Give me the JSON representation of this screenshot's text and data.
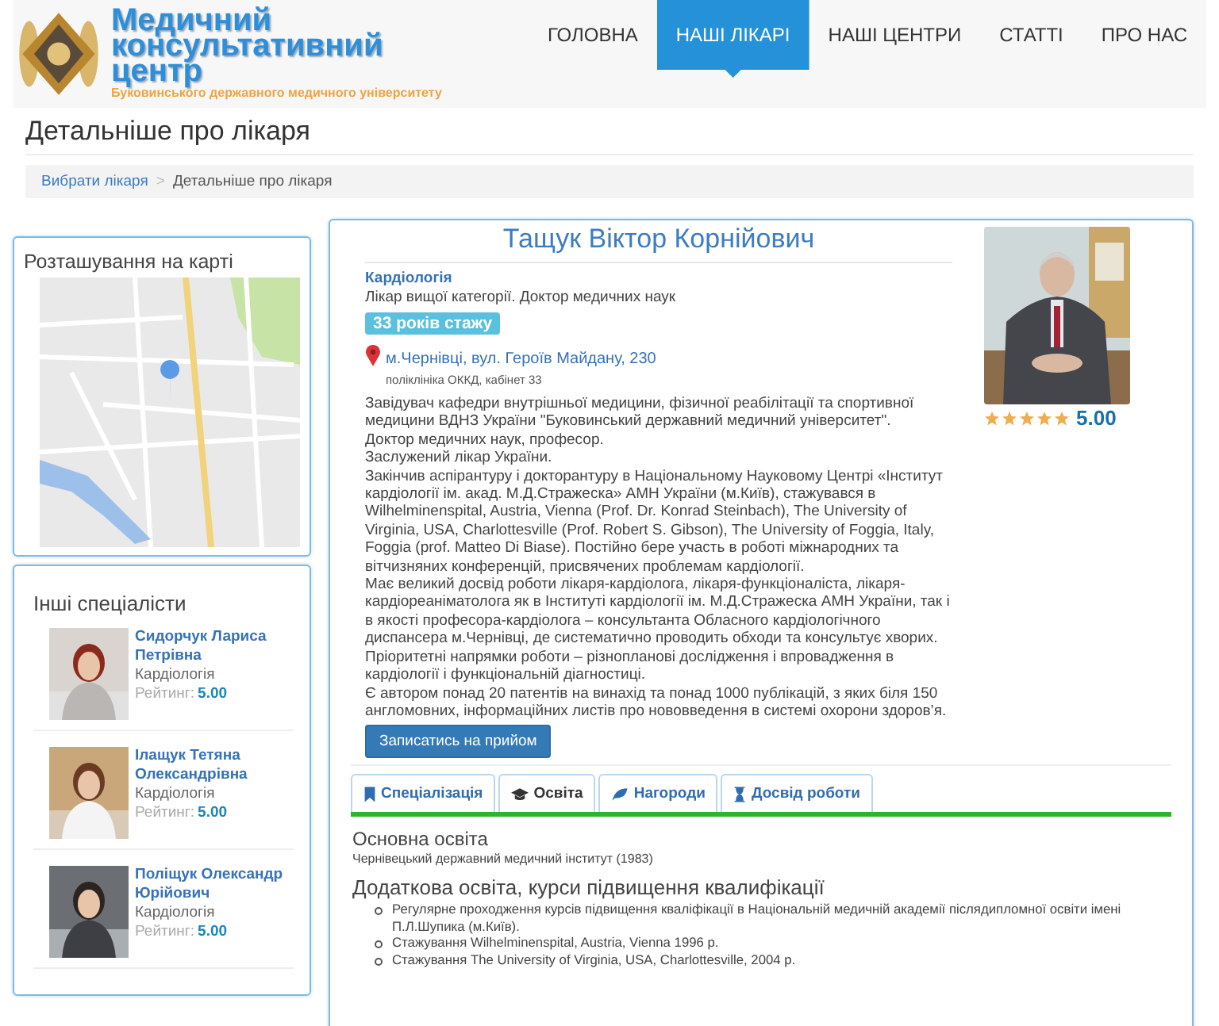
{
  "header": {
    "title": "Медичний консультативний центр",
    "subtitle": "Буковинського державного медичного університету",
    "nav": [
      {
        "label": "ГОЛОВНА",
        "selected": false
      },
      {
        "label": "НАШІ ЛІКАРІ",
        "selected": true
      },
      {
        "label": "НАШІ ЦЕНТРИ",
        "selected": false
      },
      {
        "label": "СТАТТІ",
        "selected": false
      },
      {
        "label": "ПРО НАС",
        "selected": false
      }
    ]
  },
  "page_title": "Детальніше про лікаря",
  "breadcrumb": {
    "separator": ">",
    "items": [
      {
        "label": "Вибрати лікаря",
        "kind": "link"
      },
      {
        "label": "Детальніше про лікаря",
        "kind": "current"
      }
    ]
  },
  "map_card": {
    "title": "Розташування на карті"
  },
  "others": {
    "title": "Інші спеціалісти",
    "doctors": [
      {
        "name": "Сидорчук Лариса Петрівна",
        "specialty": "Кардіологія",
        "rating_label": "Рейтинг:",
        "rating": "5.00"
      },
      {
        "name": "Ілащук Тетяна Олександрівна",
        "specialty": "Кардіологія",
        "rating_label": "Рейтинг:",
        "rating": "5.00"
      },
      {
        "name": "Поліщук Олександр Юрійович",
        "specialty": "Кардіологія",
        "rating_label": "Рейтинг:",
        "rating": "5.00"
      }
    ]
  },
  "doctor": {
    "name": "Тащук Віктор Корнійович",
    "specialty": "Кардіологія",
    "degree": "Лікар вищої категорії. Доктор медичних наук",
    "experience": "33 років стажу",
    "address": "м.Чернівці, вул. Героїв Майдану, 230",
    "address_note": "поліклініка ОККД, кабінет 33",
    "stars": 5,
    "rating": "5.00",
    "bio": [
      "Завідувач кафедри внутрішньої медицини, фізичної реабілітації та спортивної медицини ВДНЗ України \"Буковинський державний медичний університет\".",
      "Доктор медичних наук, професор.",
      "Заслужений лікар України.",
      "Закінчив аспірантуру і докторантуру в Національному Науковому Центрі «Інститут кардіології ім. акад. М.Д.Стражеска» АМН України (м.Київ), стажувався в Wilhelminenspital, Austria, Vienna (Prof. Dr. Konrad Steinbach), The University of Virginia, USA, Charlottesville (Prof. Robert S. Gibson), The University of Foggia, Italy, Foggia (prof. Matteo Di Biase). Постійно бере участь в роботі міжнародних та вітчизняних конференцій, присвячених проблемам кардіології.",
      "Має великий досвід роботи лікаря-кардіолога, лікаря-функціоналіста, лікаря-кардіореаніматолога як в Інституті кардіології ім. М.Д.Стражеска АМН України, так і в якості професора-кардіолога – консультанта Обласного кардіологічного диспансера м.Чернівці, де систематично проводить обходи та консультує хворих.",
      "Пріоритетні напрямки роботи – різнопланові дослідження і впровадження в кардіології і функціональній діагностиці.",
      "Є автором понад 20 патентів на винахід та понад 1000 публікацій, з яких біля 150 англомовних, інформаційних листів про нововведення в системі охорони здоров’я."
    ],
    "button": "Записатись на прийом",
    "tabs": [
      {
        "label": "Спеціалізація",
        "selected": false
      },
      {
        "label": "Освіта",
        "selected": true
      },
      {
        "label": "Нагороди",
        "selected": false
      },
      {
        "label": "Досвід роботи",
        "selected": false
      }
    ],
    "education": [
      {
        "heading": "Основна освіта",
        "text": "Чернівецький державний медичний інститут (1983)"
      },
      {
        "heading": "Додаткова освіта, курси підвищення квалифікації",
        "items": [
          "Регулярне проходження курсів підвищення кваліфікації в Національній медичній академії післядипломної освіти імені П.Л.Шупика (м.Київ).",
          "Стажування Wilhelminenspital, Austria, Vienna 1996 р.",
          "Стажування The University of Virginia, USA, Charlottesville, 2004 р."
        ]
      }
    ]
  }
}
